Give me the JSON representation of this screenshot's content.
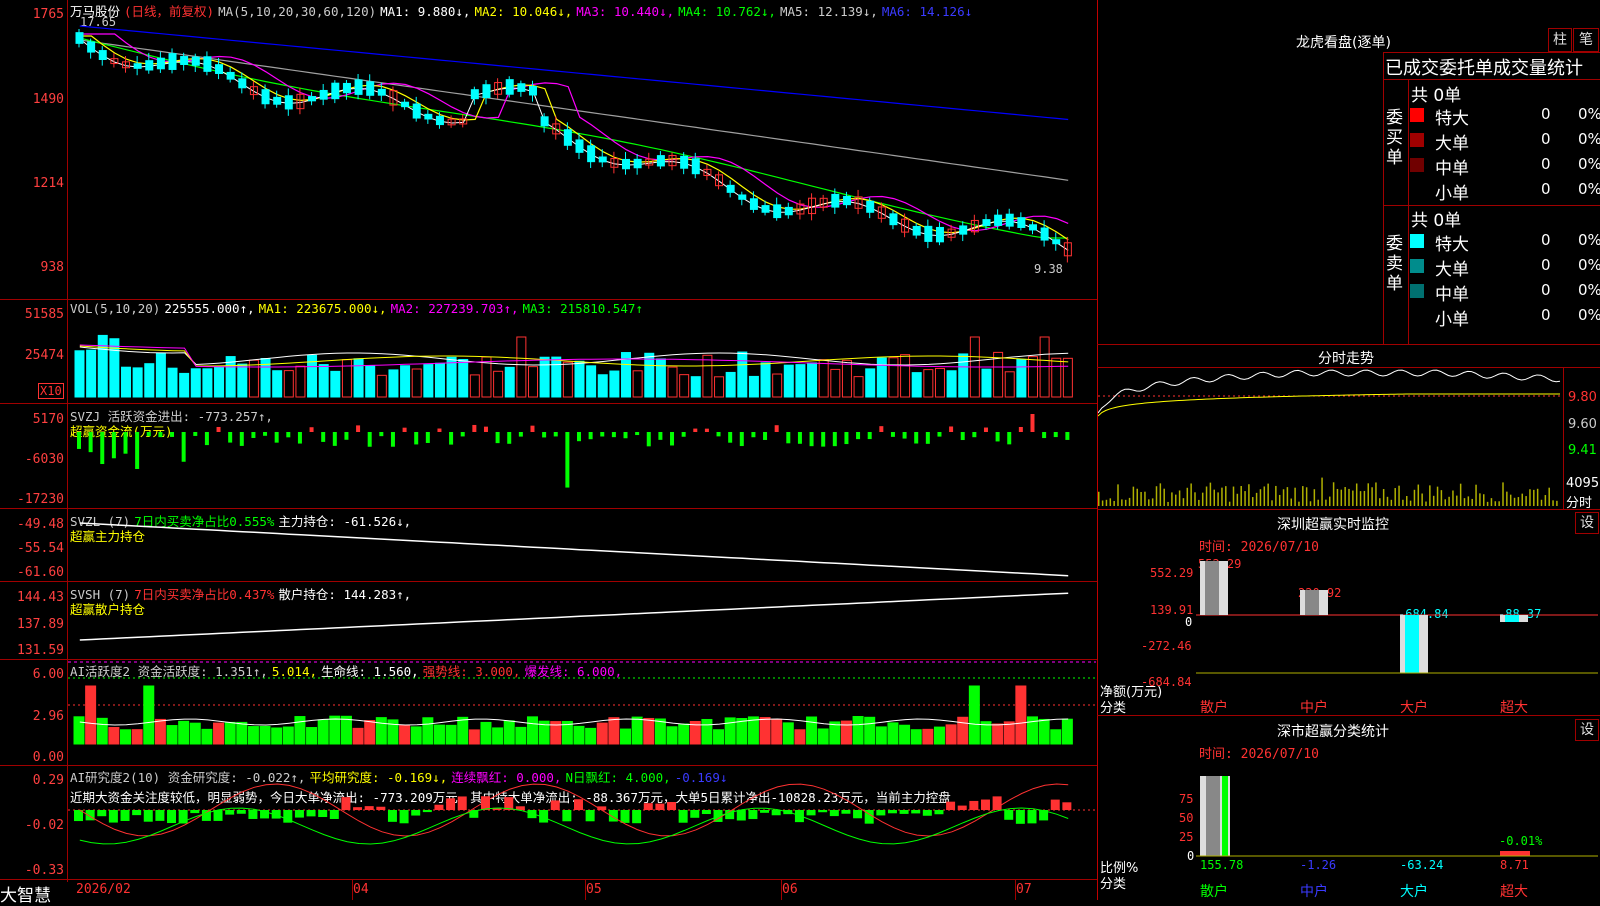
{
  "colors": {
    "up": "#ff3232",
    "down": "#00ffff",
    "ma1": "#ffffff",
    "ma2": "#ffff00",
    "ma3": "#ff00ff",
    "ma4": "#00ff00",
    "ma5": "#a0a0a0",
    "ma6": "#0000ff",
    "grid": "#a00000",
    "green": "#00ff00"
  },
  "price_panel": {
    "axis": [
      "1765",
      "1490",
      "1214",
      "938"
    ],
    "name": "万马股份",
    "mode": "(日线，前复权)",
    "ma_label": "MA(5,10,20,30,60,120)",
    "ma1": "MA1: 9.880↓,",
    "ma2": "MA2: 10.046↓,",
    "ma3": "MA3: 10.440↓,",
    "ma4": "MA4: 10.762↓,",
    "ma5": "MA5: 12.139↓,",
    "ma6": "MA6: 14.126↓",
    "high_mark": "17.65",
    "low_mark": "9.38"
  },
  "vol_panel": {
    "axis": [
      "51585",
      "25474"
    ],
    "unit": "X10",
    "label": "VOL(5,10,20)",
    "val": "225555.000↑,",
    "ma1": "MA1: 223675.000↓,",
    "ma2": "MA2: 227239.703↑,",
    "ma3": "MA3: 215810.547↑"
  },
  "svzj_panel": {
    "axis": [
      "5170",
      "-6030",
      "-17230"
    ],
    "label": "SVZJ  活跃资金进出: -773.257↑,",
    "sub": "超赢资金流(万元)"
  },
  "svzl_panel": {
    "axis": [
      "-49.48",
      "-55.54",
      "-61.60"
    ],
    "label": "SVZL (7)",
    "pct": "7日内买卖净占比0.555%",
    "main": "主力持仓: -61.526↓,",
    "sub": "超赢主力持仓"
  },
  "svsh_panel": {
    "axis": [
      "144.43",
      "137.89",
      "131.59"
    ],
    "label": "SVSH (7)",
    "pct": "7日内买卖净占比0.437%",
    "main": "散户持仓: 144.283↑,",
    "sub": "超赢散户持仓"
  },
  "ai_active": {
    "axis": [
      "6.00",
      "2.96",
      "0.00"
    ],
    "label": "AI活跃度2 资金活跃度: 1.351↑,",
    "v2": "5.014,",
    "life": "生命线: 1.560,",
    "strong": "强势线: 3.000,",
    "burst": "爆发线: 6.000,"
  },
  "ai_research": {
    "axis": [
      "0.29",
      "-0.02",
      "-0.33"
    ],
    "label": "AI研究度2(10) 资金研究度: -0.022↑,",
    "avg": "平均研究度: -0.169↓,",
    "red": "连续飘红: 0.000,",
    "ndays": "N日飘红: 4.000,",
    "last": "-0.169↓",
    "comment": "近期大资金关注度较低，明显弱势，今日大单净流出: -773.209万元，其中特大单净流出: -88.367万元，大单5日累计净出-10828.23万元，当前主力控盘"
  },
  "x_axis": {
    "start": "2026/02",
    "m4": "04",
    "m5": "05",
    "m6": "06",
    "m7": "07"
  },
  "footer": {
    "brand": "大智慧"
  },
  "lhb": {
    "title": "龙虎看盘(逐单)",
    "btn1": "柱",
    "btn2": "笔",
    "sub": "已成交委托单成交量统计",
    "buy_side": "委买单",
    "sell_side": "委卖单",
    "buy_total": "共 0单",
    "sell_total": "共 0单",
    "rows": [
      {
        "label": "特大",
        "n": "0",
        "p": "0%"
      },
      {
        "label": "大单",
        "n": "0",
        "p": "0%"
      },
      {
        "label": "中单",
        "n": "0",
        "p": "0%"
      },
      {
        "label": "小单",
        "n": "0",
        "p": "0%"
      }
    ]
  },
  "intraday": {
    "title": "分时走势",
    "axis": [
      "9.80",
      "9.60",
      "9.41"
    ],
    "vol_axis": "4095",
    "vol_label": "分时"
  },
  "sz_monitor": {
    "title": "深圳超赢实时监控",
    "btn": "设",
    "time": "时间: 2026/07/10",
    "axis": [
      "552.29",
      "139.91",
      "0",
      "-272.46",
      "-684.84"
    ],
    "left1": "净额(万元)",
    "left2": "分类",
    "cats": [
      "散户",
      "中户",
      "大户",
      "超大"
    ],
    "values": [
      "552.29",
      "220.92",
      "-684.84",
      "-88.37"
    ]
  },
  "sz_class": {
    "title": "深市超赢分类统计",
    "btn": "设",
    "time": "时间: 2026/07/10",
    "axis": [
      "75",
      "50",
      "25",
      "0"
    ],
    "left1": "比例%",
    "left2": "分类",
    "cats": [
      "散户",
      "中户",
      "大户",
      "超大"
    ],
    "values": [
      "155.78",
      "-1.26",
      "-63.24",
      "8.71"
    ],
    "top_label": "-0.01%"
  }
}
